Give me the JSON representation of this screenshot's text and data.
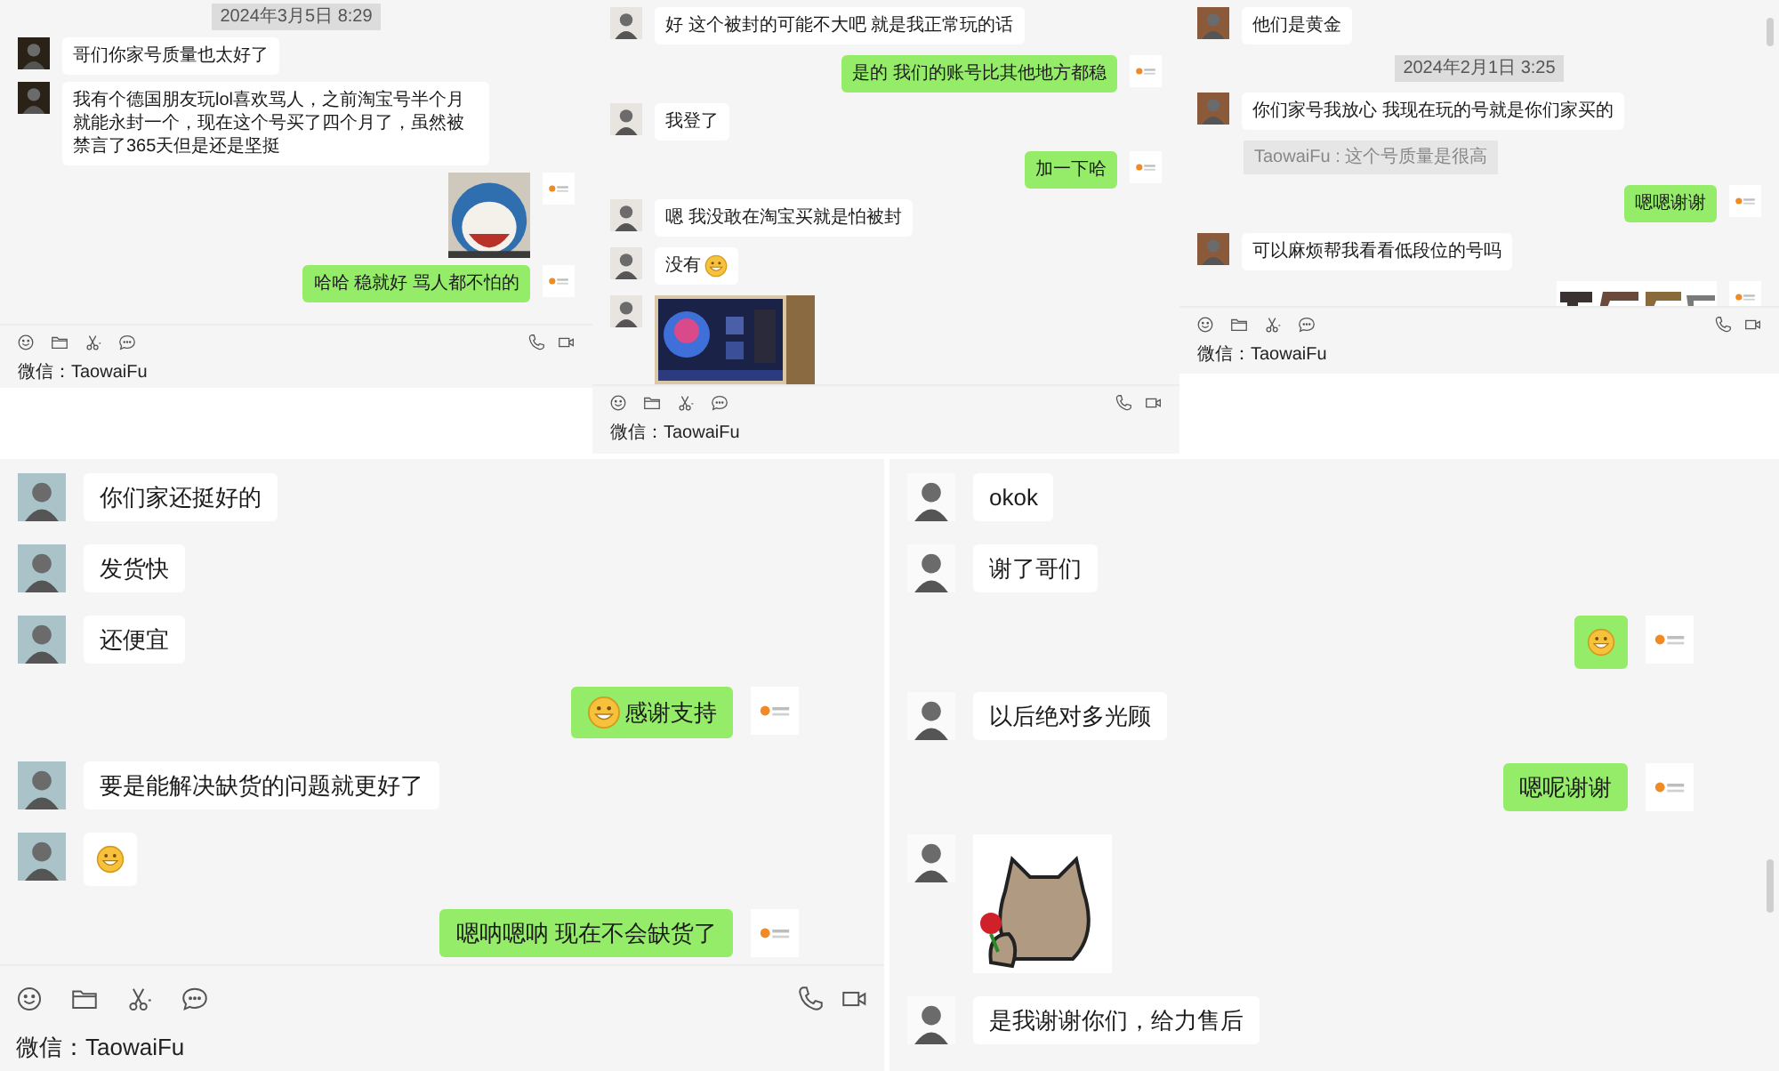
{
  "panels": [
    {
      "messages": [
        {
          "kind": "time",
          "text": "2024年3月5日 8:29"
        },
        {
          "kind": "text",
          "outgoing": false,
          "text": "哥们你家号质量也太好了"
        },
        {
          "kind": "text",
          "outgoing": false,
          "text": "我有个德国朋友玩lol喜欢骂人，之前淘宝号半个月就能永封一个，现在这个号买了四个月了，虽然被禁言了365天但是还是坚挺"
        },
        {
          "kind": "picture",
          "outgoing": true
        },
        {
          "kind": "text",
          "outgoing": true,
          "text": "哈哈 稳就好 骂人都不怕的"
        }
      ],
      "account": "微信：TaowaiFu"
    },
    {
      "messages": [
        {
          "kind": "text",
          "outgoing": false,
          "text": "好 这个被封的可能不大吧 就是我正常玩的话"
        },
        {
          "kind": "text",
          "outgoing": true,
          "text": "是的 我们的账号比其他地方都稳"
        },
        {
          "kind": "text",
          "outgoing": false,
          "text": "我登了"
        },
        {
          "kind": "text",
          "outgoing": true,
          "text": "加一下哈"
        },
        {
          "kind": "text",
          "outgoing": false,
          "text": "嗯 我没敢在淘宝买就是怕被封"
        },
        {
          "kind": "text",
          "outgoing": false,
          "text": "没有",
          "trailing_emoji": true
        },
        {
          "kind": "picture",
          "outgoing": false
        }
      ],
      "account": "微信：TaowaiFu"
    },
    {
      "messages": [
        {
          "kind": "text",
          "outgoing": false,
          "text": "他们是黄金"
        },
        {
          "kind": "time",
          "text": "2024年2月1日 3:25"
        },
        {
          "kind": "text",
          "outgoing": false,
          "text": "你们家号我放心 我现在玩的号就是你们家买的"
        },
        {
          "kind": "quote",
          "text": "TaowaiFu : 这个号质量是很高"
        },
        {
          "kind": "text",
          "outgoing": true,
          "text": "嗯嗯谢谢"
        },
        {
          "kind": "text",
          "outgoing": false,
          "text": "可以麻烦帮我看看低段位的号吗"
        },
        {
          "kind": "picture",
          "outgoing": true
        }
      ],
      "account": "微信：TaowaiFu"
    },
    {
      "messages": [
        {
          "kind": "text",
          "outgoing": false,
          "text": "你们家还挺好的"
        },
        {
          "kind": "text",
          "outgoing": false,
          "text": "发货快"
        },
        {
          "kind": "text",
          "outgoing": false,
          "text": "还便宜"
        },
        {
          "kind": "text",
          "outgoing": true,
          "text": "感谢支持",
          "leading_emoji": true
        },
        {
          "kind": "text",
          "outgoing": false,
          "text": "要是能解决缺货的问题就更好了"
        },
        {
          "kind": "emoji",
          "outgoing": false
        },
        {
          "kind": "text",
          "outgoing": true,
          "text": "嗯呐嗯呐 现在不会缺货了"
        }
      ],
      "account": "微信：TaowaiFu"
    },
    {
      "messages": [
        {
          "kind": "text",
          "outgoing": false,
          "text": "okok"
        },
        {
          "kind": "text",
          "outgoing": false,
          "text": "谢了哥们"
        },
        {
          "kind": "emoji",
          "outgoing": true
        },
        {
          "kind": "text",
          "outgoing": false,
          "text": "以后绝对多光顾"
        },
        {
          "kind": "text",
          "outgoing": true,
          "text": "嗯呢谢谢"
        },
        {
          "kind": "picture",
          "outgoing": false
        },
        {
          "kind": "text",
          "outgoing": false,
          "text": "是我谢谢你们，给力售后"
        }
      ]
    }
  ]
}
